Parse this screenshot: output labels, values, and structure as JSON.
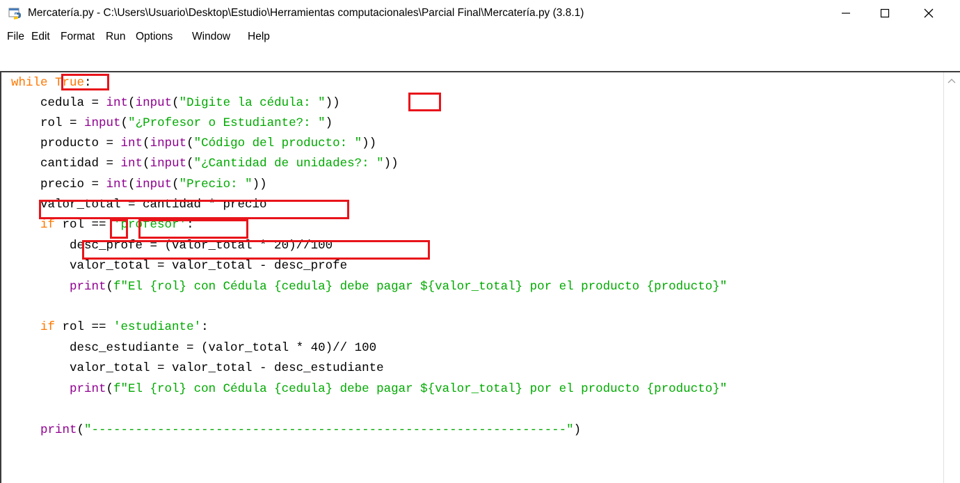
{
  "window": {
    "title": "Mercatería.py - C:\\Users\\Usuario\\Desktop\\Estudio\\Herramientas computacionales\\Parcial Final\\Mercatería.py (3.8.1)",
    "icon": "python-idle-icon",
    "controls": [
      "minimize-icon",
      "maximize-icon",
      "close-icon"
    ]
  },
  "menu": [
    "File",
    "Edit",
    "Format",
    "Run",
    "Options",
    "Window",
    "Help"
  ],
  "colors": {
    "keyword": "#ff7700",
    "builtin": "#900090",
    "string": "#00aa00",
    "highlight_box": "#e8141a"
  },
  "code": [
    [
      {
        "t": "while",
        "c": "kw"
      },
      {
        "t": " ",
        "c": "plain"
      },
      {
        "t": "True",
        "c": "kw"
      },
      {
        "t": ":",
        "c": "plain"
      }
    ],
    [
      {
        "t": "    cedula = ",
        "c": "plain"
      },
      {
        "t": "int",
        "c": "bi"
      },
      {
        "t": "(",
        "c": "plain"
      },
      {
        "t": "input",
        "c": "bi"
      },
      {
        "t": "(",
        "c": "plain"
      },
      {
        "t": "\"Digite la cédula: \"",
        "c": "str"
      },
      {
        "t": "))",
        "c": "plain"
      }
    ],
    [
      {
        "t": "    rol = ",
        "c": "plain"
      },
      {
        "t": "input",
        "c": "bi"
      },
      {
        "t": "(",
        "c": "plain"
      },
      {
        "t": "\"¿Profesor o Estudiante?: \"",
        "c": "str"
      },
      {
        "t": ")",
        "c": "plain"
      }
    ],
    [
      {
        "t": "    producto = ",
        "c": "plain"
      },
      {
        "t": "int",
        "c": "bi"
      },
      {
        "t": "(",
        "c": "plain"
      },
      {
        "t": "input",
        "c": "bi"
      },
      {
        "t": "(",
        "c": "plain"
      },
      {
        "t": "\"Código del producto: \"",
        "c": "str"
      },
      {
        "t": "))",
        "c": "plain"
      }
    ],
    [
      {
        "t": "    cantidad = ",
        "c": "plain"
      },
      {
        "t": "int",
        "c": "bi"
      },
      {
        "t": "(",
        "c": "plain"
      },
      {
        "t": "input",
        "c": "bi"
      },
      {
        "t": "(",
        "c": "plain"
      },
      {
        "t": "\"¿Cantidad de unidades?: \"",
        "c": "str"
      },
      {
        "t": "))",
        "c": "plain"
      }
    ],
    [
      {
        "t": "    precio = ",
        "c": "plain"
      },
      {
        "t": "int",
        "c": "bi"
      },
      {
        "t": "(",
        "c": "plain"
      },
      {
        "t": "input",
        "c": "bi"
      },
      {
        "t": "(",
        "c": "plain"
      },
      {
        "t": "\"Precio: \"",
        "c": "str"
      },
      {
        "t": "))",
        "c": "plain"
      }
    ],
    [
      {
        "t": "    valor_total = cantidad * precio",
        "c": "plain"
      }
    ],
    [
      {
        "t": "    ",
        "c": "plain"
      },
      {
        "t": "if",
        "c": "kw"
      },
      {
        "t": " rol == ",
        "c": "plain"
      },
      {
        "t": "'profesor'",
        "c": "str"
      },
      {
        "t": ":",
        "c": "plain"
      }
    ],
    [
      {
        "t": "        desc_profe = (valor_total * 20)//100",
        "c": "plain"
      }
    ],
    [
      {
        "t": "        valor_total = valor_total - desc_profe",
        "c": "plain"
      }
    ],
    [
      {
        "t": "        ",
        "c": "plain"
      },
      {
        "t": "print",
        "c": "bi"
      },
      {
        "t": "(",
        "c": "plain"
      },
      {
        "t": "f\"El {rol} con Cédula {cedula} debe pagar ${valor_total} por el producto {producto}\"",
        "c": "str"
      }
    ],
    [],
    [
      {
        "t": "    ",
        "c": "plain"
      },
      {
        "t": "if",
        "c": "kw"
      },
      {
        "t": " rol == ",
        "c": "plain"
      },
      {
        "t": "'estudiante'",
        "c": "str"
      },
      {
        "t": ":",
        "c": "plain"
      }
    ],
    [
      {
        "t": "        desc_estudiante = (valor_total * 40)// 100",
        "c": "plain"
      }
    ],
    [
      {
        "t": "        valor_total = valor_total - desc_estudiante",
        "c": "plain"
      }
    ],
    [
      {
        "t": "        ",
        "c": "plain"
      },
      {
        "t": "print",
        "c": "bi"
      },
      {
        "t": "(",
        "c": "plain"
      },
      {
        "t": "f\"El {rol} con Cédula {cedula} debe pagar ${valor_total} por el producto {producto}\"",
        "c": "str"
      }
    ],
    [],
    [
      {
        "t": "    ",
        "c": "plain"
      },
      {
        "t": "print",
        "c": "bi"
      },
      {
        "t": "(",
        "c": "plain"
      },
      {
        "t": "\"-----------------------------------------------------------------\"",
        "c": "str"
      },
      {
        "t": ")",
        "c": "plain"
      }
    ]
  ]
}
